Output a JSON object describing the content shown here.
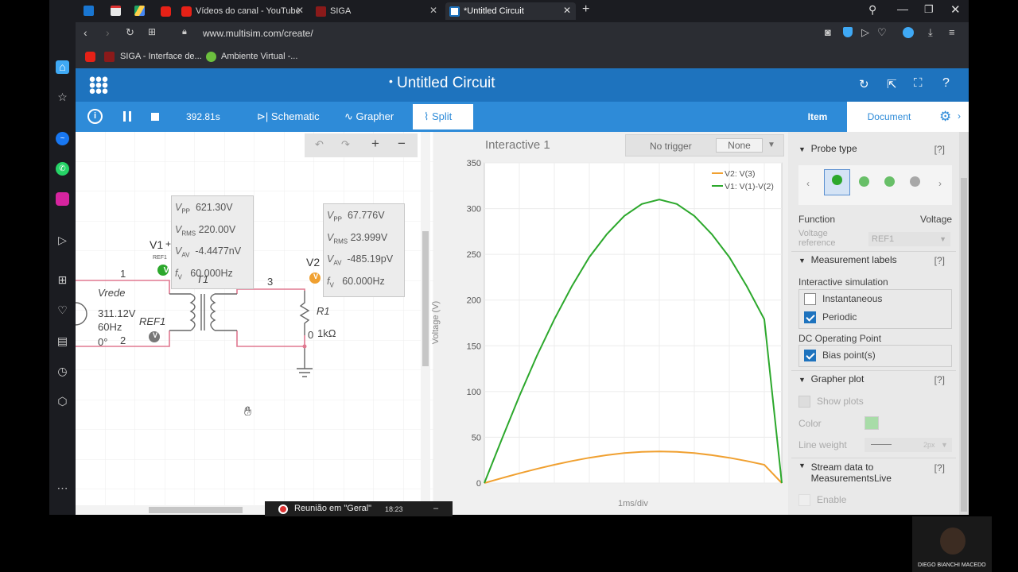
{
  "browser": {
    "tabs": [
      {
        "label": "Vídeos do canal - YouTube"
      },
      {
        "label": "SIGA"
      },
      {
        "label": "*Untitled Circuit"
      }
    ],
    "url": "www.multisim.com/create/",
    "bookmarks": [
      "SIGA - Interface de...",
      "Ambiente Virtual -..."
    ]
  },
  "app": {
    "title": "Untitled Circuit",
    "title_marker": "•",
    "sim_time": "392.81s",
    "tabs": {
      "schematic": "Schematic",
      "grapher": "Grapher",
      "split": "Split"
    },
    "active_tab": "split"
  },
  "schematic": {
    "v1_measure": {
      "vpp": "621.30V",
      "vrms": "220.00V",
      "vav": "-4.4477nV",
      "fv": "60.000Hz"
    },
    "v2_measure": {
      "vpp": "67.776V",
      "vrms": "23.999V",
      "vav": "-485.19pV",
      "fv": "60.000Hz"
    },
    "labels": {
      "v1": "V1",
      "v2": "V2",
      "ref1_small": "REF1",
      "t1": "T1",
      "node1": "1",
      "node2": "2",
      "node3": "3",
      "node0": "0",
      "source_name": "Vrede",
      "source_v": "311.12V",
      "source_f": "60Hz",
      "source_p": "0°",
      "ref1": "REF1",
      "r1": "R1",
      "r1_val": "1kΩ"
    }
  },
  "grapher": {
    "title": "Interactive 1",
    "trigger": "No trigger",
    "trigger_select": "None",
    "xlabel": "1ms/div",
    "ylabel": "Voltage (V)"
  },
  "chart_data": {
    "type": "line",
    "ylim": [
      0,
      350
    ],
    "yticks": [
      0,
      50,
      100,
      150,
      200,
      250,
      300,
      350
    ],
    "x": [
      0,
      0.5,
      1,
      1.5,
      2,
      2.5,
      3,
      3.5,
      4,
      4.5,
      5,
      5.5,
      6,
      6.5,
      7,
      7.5,
      8,
      8.5
    ],
    "xlim": [
      0,
      8.5
    ],
    "grid": true,
    "legend_position": "top-right",
    "series": [
      {
        "name": "V2: V(3)",
        "color": "#f0a030",
        "values": [
          0,
          5.4,
          10.6,
          15.5,
          20,
          24.1,
          27.6,
          30.5,
          32.7,
          34.1,
          34.6,
          34.1,
          32.7,
          30.5,
          27.6,
          24.1,
          20,
          0
        ]
      },
      {
        "name": "V1: V(1)-V(2)",
        "color": "#2ca82c",
        "values": [
          0,
          48,
          95,
          139,
          179,
          215,
          247,
          272,
          292,
          305,
          310,
          305,
          292,
          272,
          247,
          215,
          179,
          0
        ]
      }
    ]
  },
  "panel": {
    "tab_item": "Item",
    "tab_document": "Document",
    "probe_type": "Probe type",
    "function_label": "Function",
    "function_value": "Voltage",
    "voltage_ref_label": "Voltage reference",
    "voltage_ref_value": "REF1",
    "measurement_labels": "Measurement labels",
    "interactive_sim": "Interactive simulation",
    "instantaneous": "Instantaneous",
    "periodic": "Periodic",
    "dc_op": "DC Operating Point",
    "bias_points": "Bias point(s)",
    "grapher_plot": "Grapher plot",
    "show_plots": "Show plots",
    "color_label": "Color",
    "plot_color": "#a8dca8",
    "line_weight": "Line weight",
    "line_weight_value": "2px",
    "stream_data": "Stream data to MeasurementsLive",
    "enable": "Enable",
    "help": "[?]"
  },
  "overlay": {
    "meeting": "Reunião em \"Geral\"",
    "meeting_time": "18:23",
    "presenter": "DIEGO BIANCHI MACEDO"
  }
}
